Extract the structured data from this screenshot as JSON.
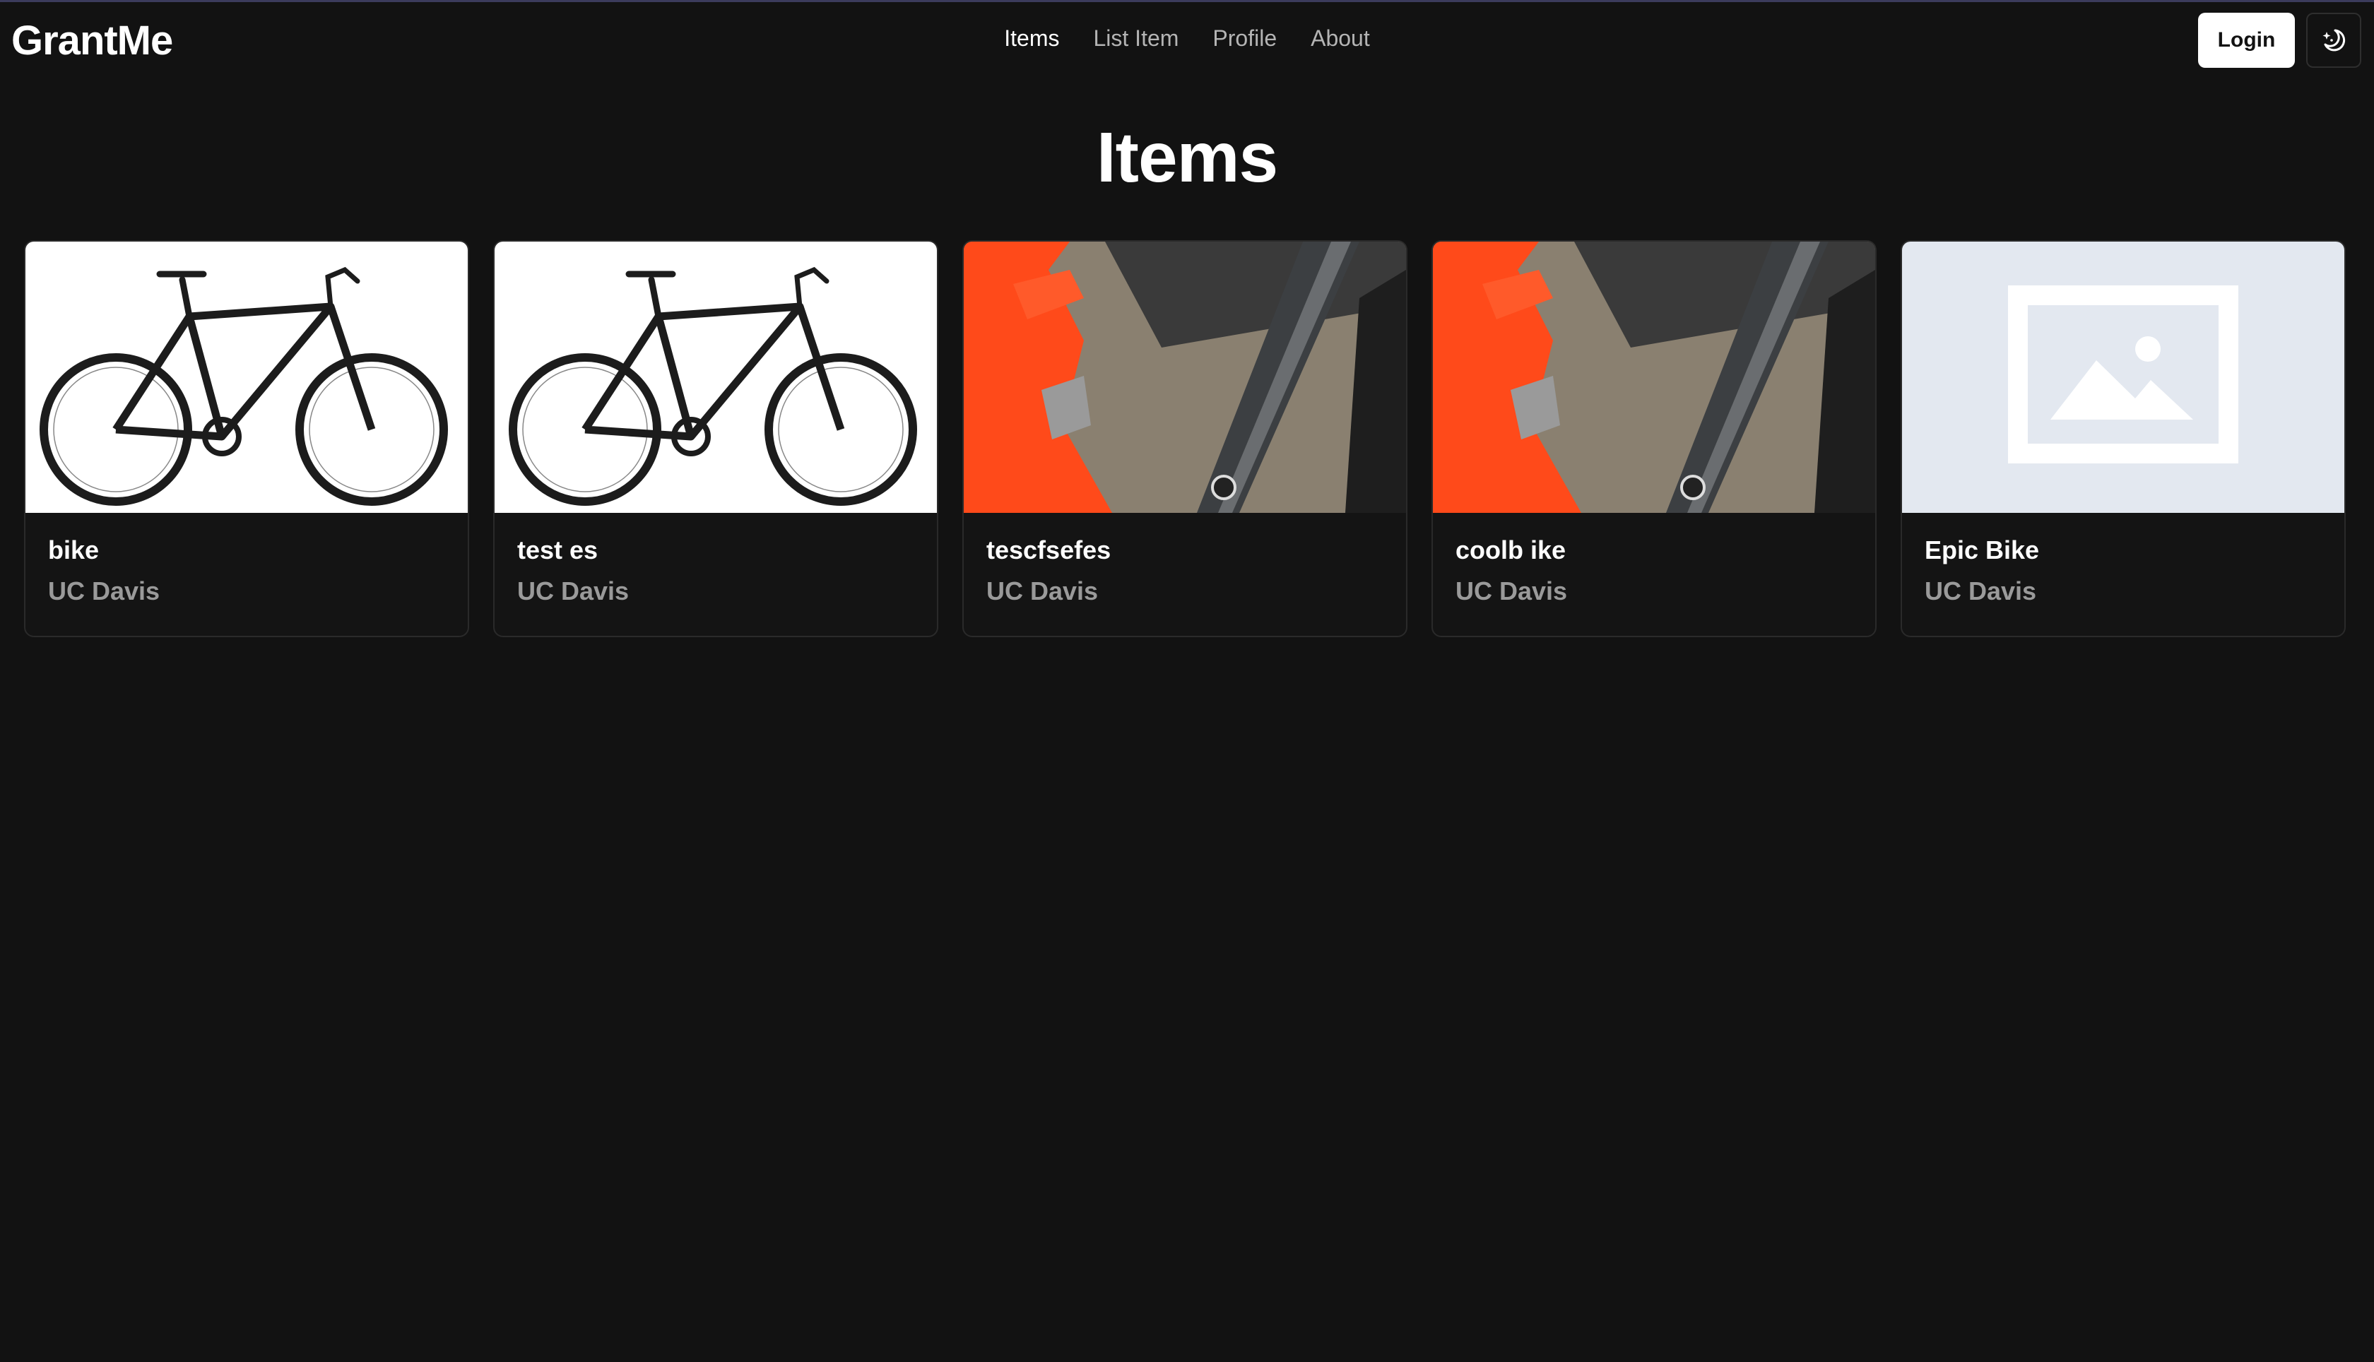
{
  "header": {
    "brand": "GrantMe",
    "nav": [
      {
        "label": "Items",
        "active": true
      },
      {
        "label": "List Item",
        "active": false
      },
      {
        "label": "Profile",
        "active": false
      },
      {
        "label": "About",
        "active": false
      }
    ],
    "login_label": "Login",
    "theme_toggle_icon": "moon-sparkle-icon"
  },
  "main": {
    "title": "Items",
    "items": [
      {
        "name": "bike",
        "location": "UC Davis",
        "image": "bicycle-photo"
      },
      {
        "name": "test es",
        "location": "UC Davis",
        "image": "bicycle-photo"
      },
      {
        "name": "tescfsefes",
        "location": "UC Davis",
        "image": "frame-closeup-photo"
      },
      {
        "name": "coolb ike",
        "location": "UC Davis",
        "image": "frame-closeup-photo"
      },
      {
        "name": "Epic Bike",
        "location": "UC Davis",
        "image": "image-placeholder-icon"
      }
    ]
  },
  "colors": {
    "background": "#121212",
    "card_border": "#2a2a2a",
    "muted_text": "#9a9a9a",
    "placeholder_bg": "#e3e8f0"
  }
}
